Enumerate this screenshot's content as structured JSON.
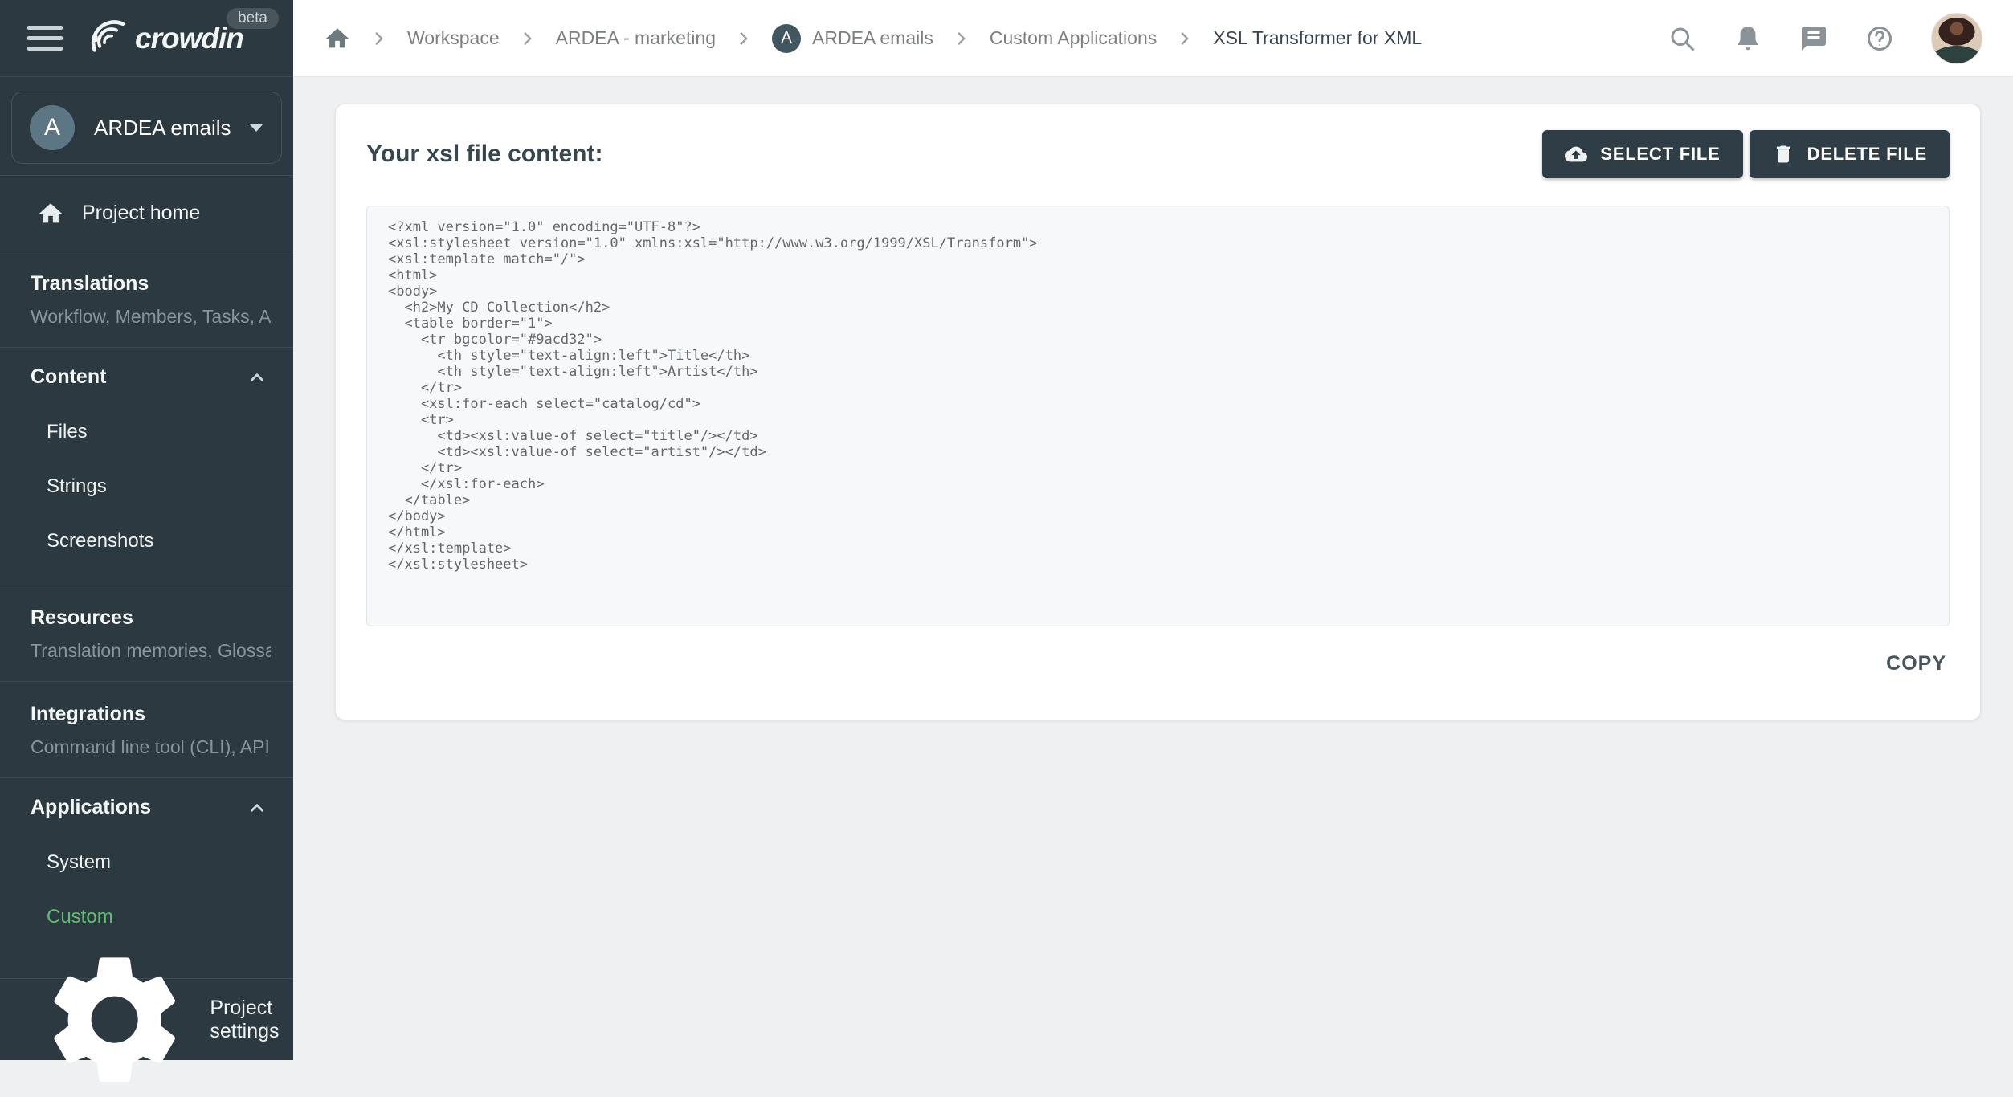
{
  "brand": {
    "name": "crowdin",
    "beta_label": "beta",
    "accent_green": "#5dbe72",
    "sidebar_bg": "#2d3940",
    "button_bg": "#2f3e46"
  },
  "sidebar": {
    "project_selector": {
      "initial": "A",
      "name": "ARDEA emails"
    },
    "project_home_label": "Project home",
    "sections": {
      "translations": {
        "title": "Translations",
        "subtitle": "Workflow, Members, Tasks, Act…"
      },
      "content": {
        "title": "Content",
        "items": {
          "files": "Files",
          "strings": "Strings",
          "screenshots": "Screenshots"
        }
      },
      "resources": {
        "title": "Resources",
        "subtitle": "Translation memories, Glossari…"
      },
      "integrations": {
        "title": "Integrations",
        "subtitle": "Command line tool (CLI), API, A…"
      },
      "applications": {
        "title": "Applications",
        "items": {
          "system": "System",
          "custom": "Custom"
        }
      }
    },
    "project_settings_label": "Project settings"
  },
  "topbar": {
    "breadcrumb": {
      "project_initial": "A",
      "items": {
        "workspace": "Workspace",
        "org": "ARDEA - marketing",
        "project": "ARDEA emails",
        "section": "Custom Applications",
        "current": "XSL Transformer for XML"
      }
    },
    "icons": [
      "search-icon",
      "notifications-bell-icon",
      "messages-icon",
      "help-icon",
      "user-avatar"
    ]
  },
  "main": {
    "heading": "Your xsl file content:",
    "select_file_label": "SELECT FILE",
    "delete_file_label": "DELETE FILE",
    "copy_label": "COPY",
    "code_lines": [
      "<?xml version=\"1.0\" encoding=\"UTF-8\"?>",
      "<xsl:stylesheet version=\"1.0\" xmlns:xsl=\"http://www.w3.org/1999/XSL/Transform\">",
      "<xsl:template match=\"/\">",
      "<html>",
      "<body>",
      "  <h2>My CD Collection</h2>",
      "  <table border=\"1\">",
      "    <tr bgcolor=\"#9acd32\">",
      "      <th style=\"text-align:left\">Title</th>",
      "      <th style=\"text-align:left\">Artist</th>",
      "    </tr>",
      "    <xsl:for-each select=\"catalog/cd\">",
      "    <tr>",
      "      <td><xsl:value-of select=\"title\"/></td>",
      "      <td><xsl:value-of select=\"artist\"/></td>",
      "    </tr>",
      "    </xsl:for-each>",
      "  </table>",
      "</body>",
      "</html>",
      "</xsl:template>",
      "</xsl:stylesheet>"
    ]
  }
}
